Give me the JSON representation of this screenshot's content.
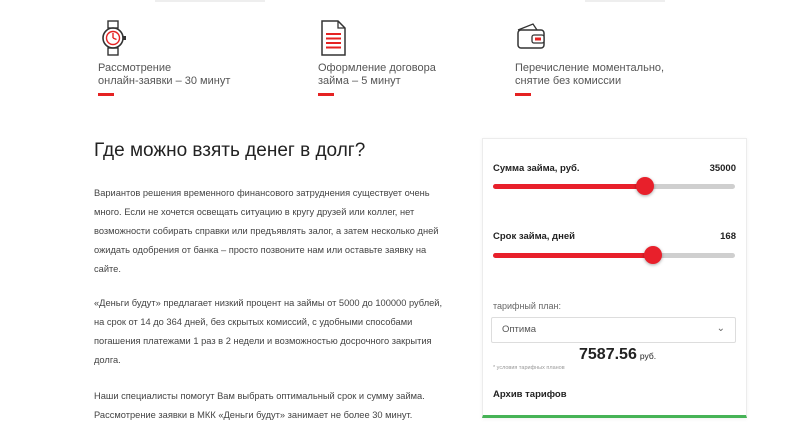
{
  "features": [
    {
      "icon": "watch-icon",
      "lines": [
        "Рассмотрение",
        "онлайн-заявки – 30 минут"
      ]
    },
    {
      "icon": "document-icon",
      "lines": [
        "Оформление договора",
        "займа – 5 минут"
      ]
    },
    {
      "icon": "wallet-icon",
      "lines": [
        "Перечисление моментально,",
        "снятие без комиссии"
      ]
    }
  ],
  "article": {
    "title": "Где можно взять денег в долг?",
    "paragraphs": [
      [
        "Вариантов решения временного финансового затруднения существует очень",
        "много. Если не хочется освещать ситуацию в кругу друзей или коллег, нет",
        "возможности собирать справки или предъявлять залог, а затем несколько дней",
        "ожидать одобрения от банка – просто позвоните нам или оставьте заявку на",
        "сайте."
      ],
      [
        "«Деньги будут» предлагает низкий процент на займы от 5000 до 100000 рублей,",
        "на срок от 14 до 364 дней, без скрытых комиссий, с удобными способами",
        "погашения платежами 1 раз в 2 недели и возможностью досрочного закрытия",
        "долга."
      ],
      [
        "Наши специалисты помогут Вам выбрать оптимальный срок и сумму займа.",
        "Рассмотрение заявки в МКК «Деньги будут» занимает не более 30 минут."
      ]
    ]
  },
  "calculator": {
    "amount_label": "Сумма займа, руб.",
    "amount_value": "35000",
    "amount_fraction": 0.63,
    "term_label": "Срок займа, дней",
    "term_value": "168",
    "term_fraction": 0.66,
    "plan_label": "тарифный план:",
    "plan_selected": "Оптима",
    "conditions_note": "* условия тарифных планов",
    "total": "7587.56",
    "currency": "руб.",
    "archive_label": "Архив тарифов",
    "accent": "#e8202b",
    "bottom_border": "#46b356"
  }
}
